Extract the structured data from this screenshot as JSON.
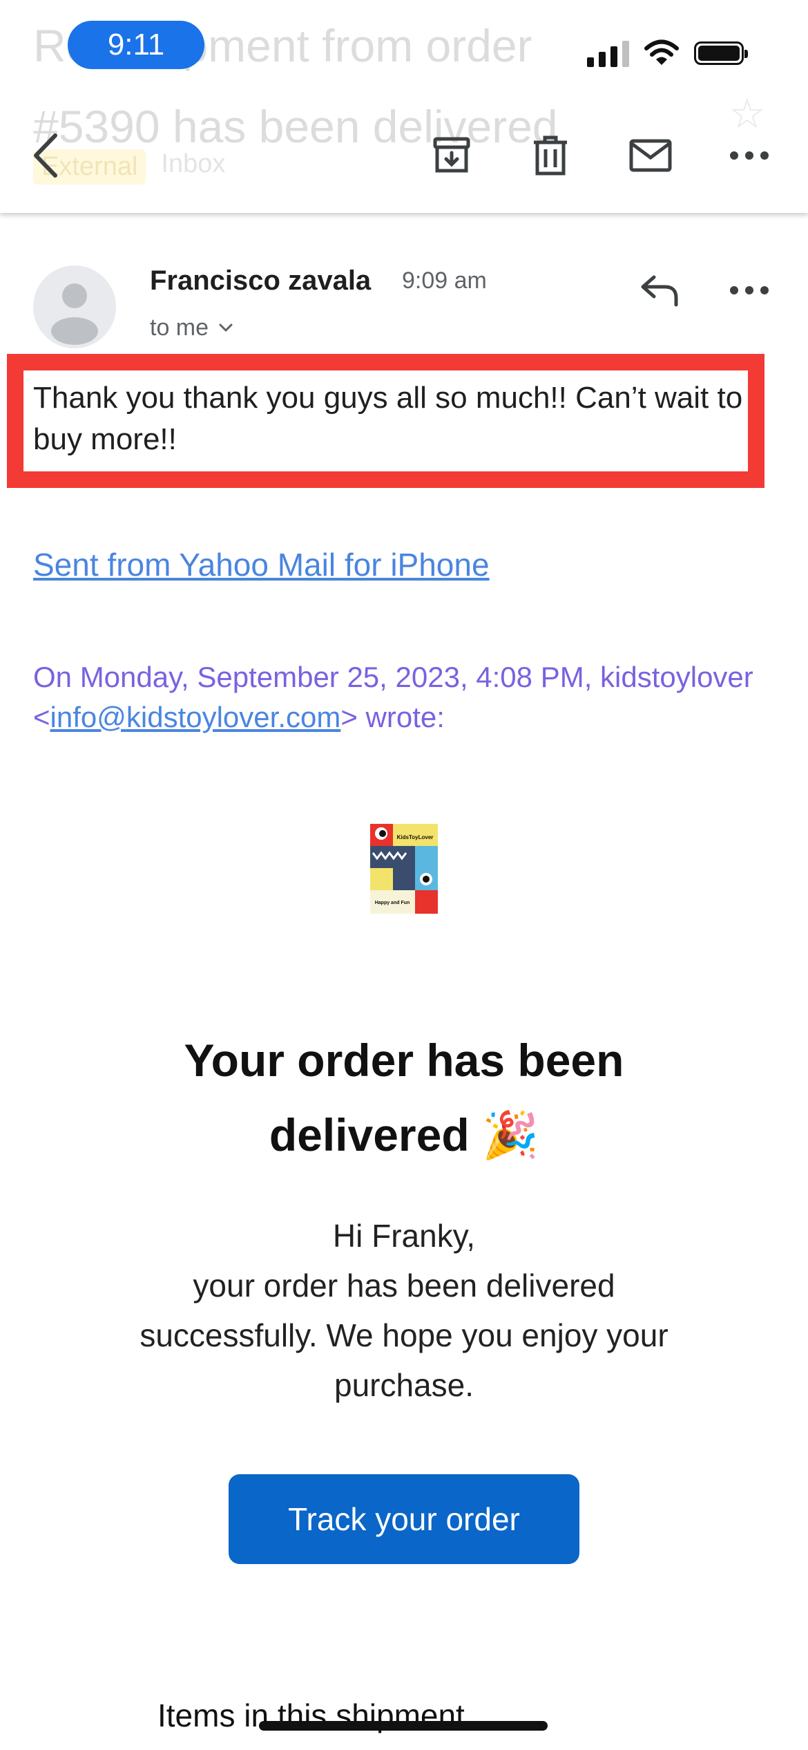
{
  "status_bar": {
    "time": "9:11"
  },
  "background_header": {
    "subject_line1": "Re: Shipment from order",
    "subject_line2": "#5390 has been delivered",
    "label_external": "External",
    "label_inbox": "Inbox"
  },
  "toolbar": {
    "back_icon": "chevron-left-icon",
    "archive_icon": "archive-icon",
    "delete_icon": "trash-icon",
    "mark_unread_icon": "envelope-icon",
    "more_icon": "more-horizontal-icon"
  },
  "message": {
    "sender": "Francisco zavala",
    "time": "9:09 am",
    "recipient": "to me",
    "reply_text": "Thank you thank you guys all so much!! Can’t wait to buy more!!",
    "sent_from_link": "Sent from Yahoo Mail for iPhone",
    "quote_prefix": "On Monday, September 25, 2023, 4:08 PM, kidstoylover <",
    "quote_email": "info@kidstoylover.com",
    "quote_suffix": "> wrote:"
  },
  "email_content": {
    "logo_text_top": "KidsToyLover",
    "logo_text_bottom": "Happy and Fun",
    "headline": "Your order has been delivered 🎉",
    "greeting": "Hi Franky,",
    "body": "your order has been delivered successfully. We hope you enjoy your purchase.",
    "track_button": "Track your order",
    "items_heading": "Items in this shipment"
  },
  "colors": {
    "accent": "#1a73e8",
    "highlight_border": "#f33a35",
    "link": "#4a85e0",
    "quote": "#7b61e0",
    "button": "#0a66c8"
  }
}
